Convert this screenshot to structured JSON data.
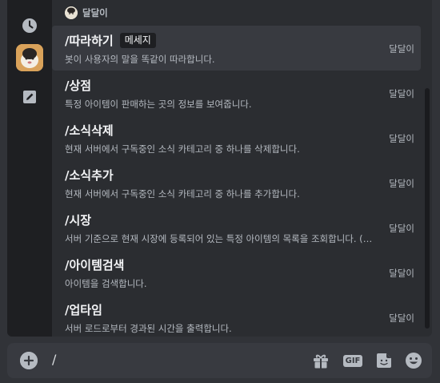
{
  "section_header": {
    "bot_name": "달달이"
  },
  "commands": [
    {
      "name": "/따라하기",
      "tag": "메세지",
      "description": "봇이 사용자의 말을 똑같이 따라합니다.",
      "bot": "달달이",
      "active": true
    },
    {
      "name": "/상점",
      "tag": "",
      "description": "특정 아이템이 판매하는 곳의 정보를 보여줍니다.",
      "bot": "달달이",
      "active": false
    },
    {
      "name": "/소식삭제",
      "tag": "",
      "description": "현재 서버에서 구독중인 소식 카테고리 중 하나를 삭제합니다.",
      "bot": "달달이",
      "active": false
    },
    {
      "name": "/소식추가",
      "tag": "",
      "description": "현재 서버에서 구독중인 소식 카테고리 중 하나를 추가합니다.",
      "bot": "달달이",
      "active": false
    },
    {
      "name": "/시장",
      "tag": "",
      "description": "서버 기준으로 현재 시장에 등록되어 있는 특정 아이템의 목록을 조회합니다. (글…",
      "bot": "달달이",
      "active": false
    },
    {
      "name": "/아이템검색",
      "tag": "",
      "description": "아이템을 검색합니다.",
      "bot": "달달이",
      "active": false
    },
    {
      "name": "/업타임",
      "tag": "",
      "description": "서버 로드로부터 경과된 시간을 출력합니다.",
      "bot": "달달이",
      "active": false
    }
  ],
  "input": {
    "value": "/"
  },
  "icons": {
    "rail": [
      "clock-icon",
      "bot-avatar",
      "pencil-icon"
    ],
    "toolbar": [
      "plus-icon",
      "gift-icon",
      "gif-icon",
      "sticker-icon",
      "emoji-icon"
    ]
  },
  "toolbar": {
    "gif_label": "GIF"
  },
  "colors": {
    "background": "#313338",
    "popup": "#2b2d31",
    "rail": "#1e1f22",
    "active_row": "#383a40",
    "text_primary": "#f2f3f5",
    "text_muted": "#b5bac1"
  }
}
